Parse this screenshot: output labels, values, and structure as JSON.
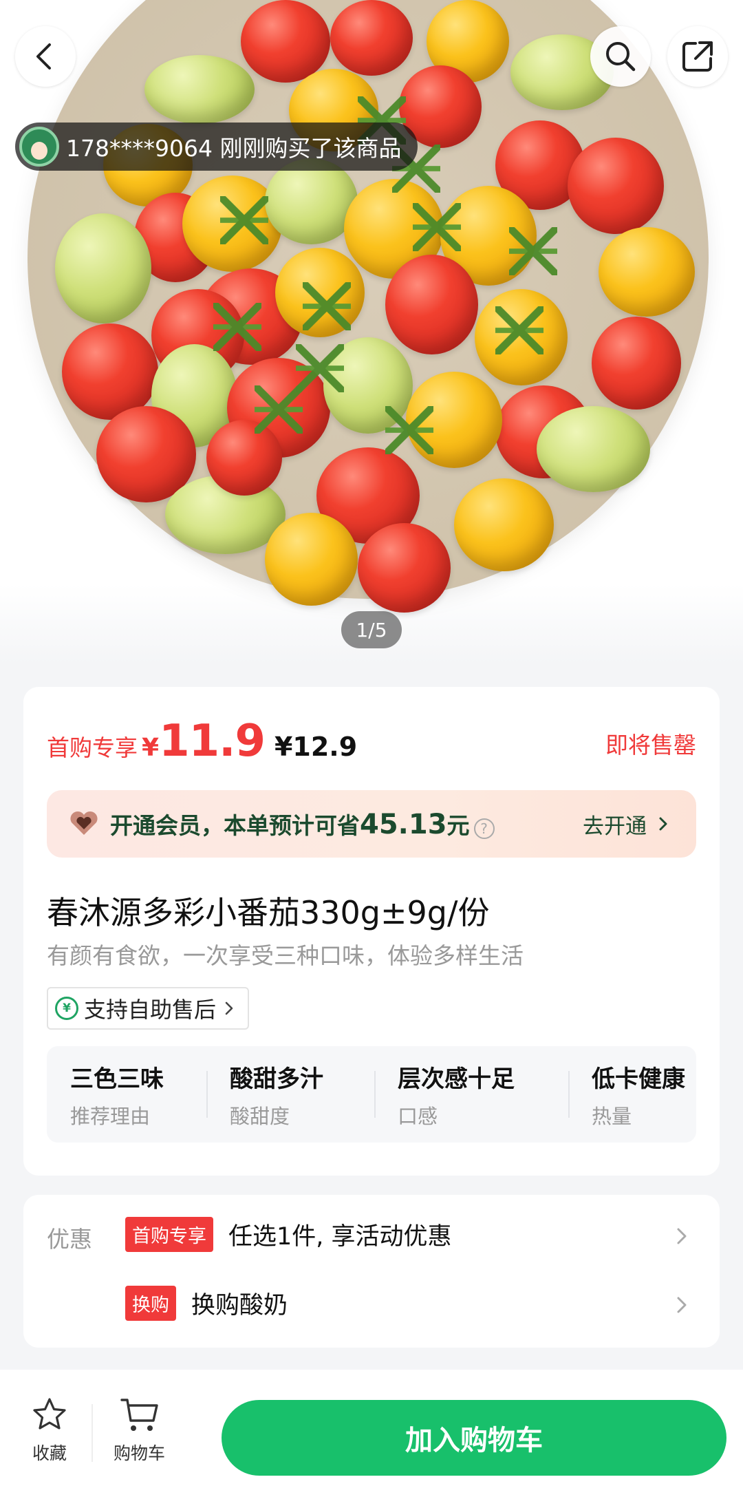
{
  "hero": {
    "buyer_notice": "178****9064 刚刚购买了该商品",
    "page_counter": "1/5"
  },
  "price": {
    "first_purchase_tag": "首购专享",
    "currency": "¥",
    "current": "11.9",
    "original": "¥12.9",
    "stock_status": "即将售罄"
  },
  "member": {
    "text_prefix": "开通会员，本单预计可省",
    "amount": "45.13",
    "unit": "元",
    "help": "?",
    "link": "去开通"
  },
  "product": {
    "title": "春沐源多彩小番茄330g±9g/份",
    "subtitle": "有颜有食欲，一次享受三种口味，体验多样生活",
    "service": "支持自助售后",
    "service_icon_glyph": "¥"
  },
  "attributes": [
    {
      "value": "三色三味",
      "key": "推荐理由"
    },
    {
      "value": "酸甜多汁",
      "key": "酸甜度"
    },
    {
      "value": "层次感十足",
      "key": "口感"
    },
    {
      "value": "低卡健康",
      "key": "热量"
    }
  ],
  "promo": {
    "label": "优惠",
    "items": [
      {
        "badge": "首购专享",
        "text": "任选1件, 享活动优惠"
      },
      {
        "badge": "换购",
        "text": "换购酸奶"
      }
    ]
  },
  "bottom_bar": {
    "favorite": "收藏",
    "cart": "购物车",
    "add_to_cart": "加入购物车"
  },
  "colors": {
    "accent_green": "#18c06b",
    "price_red": "#f03a3a",
    "member_text": "#1b4a2e"
  },
  "icons": [
    "back-icon",
    "search-icon",
    "share-icon",
    "heart-icon",
    "star-icon",
    "cart-icon",
    "chevron-right-icon"
  ]
}
